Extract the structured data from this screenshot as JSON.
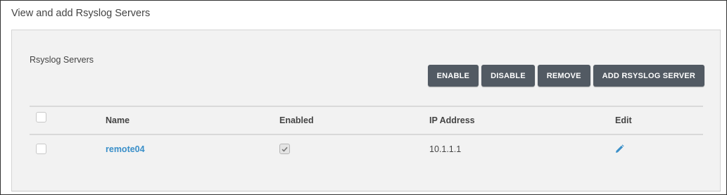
{
  "page": {
    "title": "View and add Rsyslog Servers"
  },
  "section": {
    "title": "Rsyslog Servers"
  },
  "toolbar": {
    "enable_label": "ENABLE",
    "disable_label": "DISABLE",
    "remove_label": "REMOVE",
    "add_label": "ADD RSYSLOG SERVER"
  },
  "table": {
    "columns": {
      "name": "Name",
      "enabled": "Enabled",
      "ip": "IP Address",
      "edit": "Edit"
    },
    "rows": [
      {
        "name": "remote04",
        "enabled": true,
        "ip": "10.1.1.1",
        "edit_icon": "pencil-icon"
      }
    ]
  },
  "colors": {
    "button_bg": "#525a63",
    "link": "#3a8fc9",
    "panel_bg": "#f2f2f2"
  }
}
